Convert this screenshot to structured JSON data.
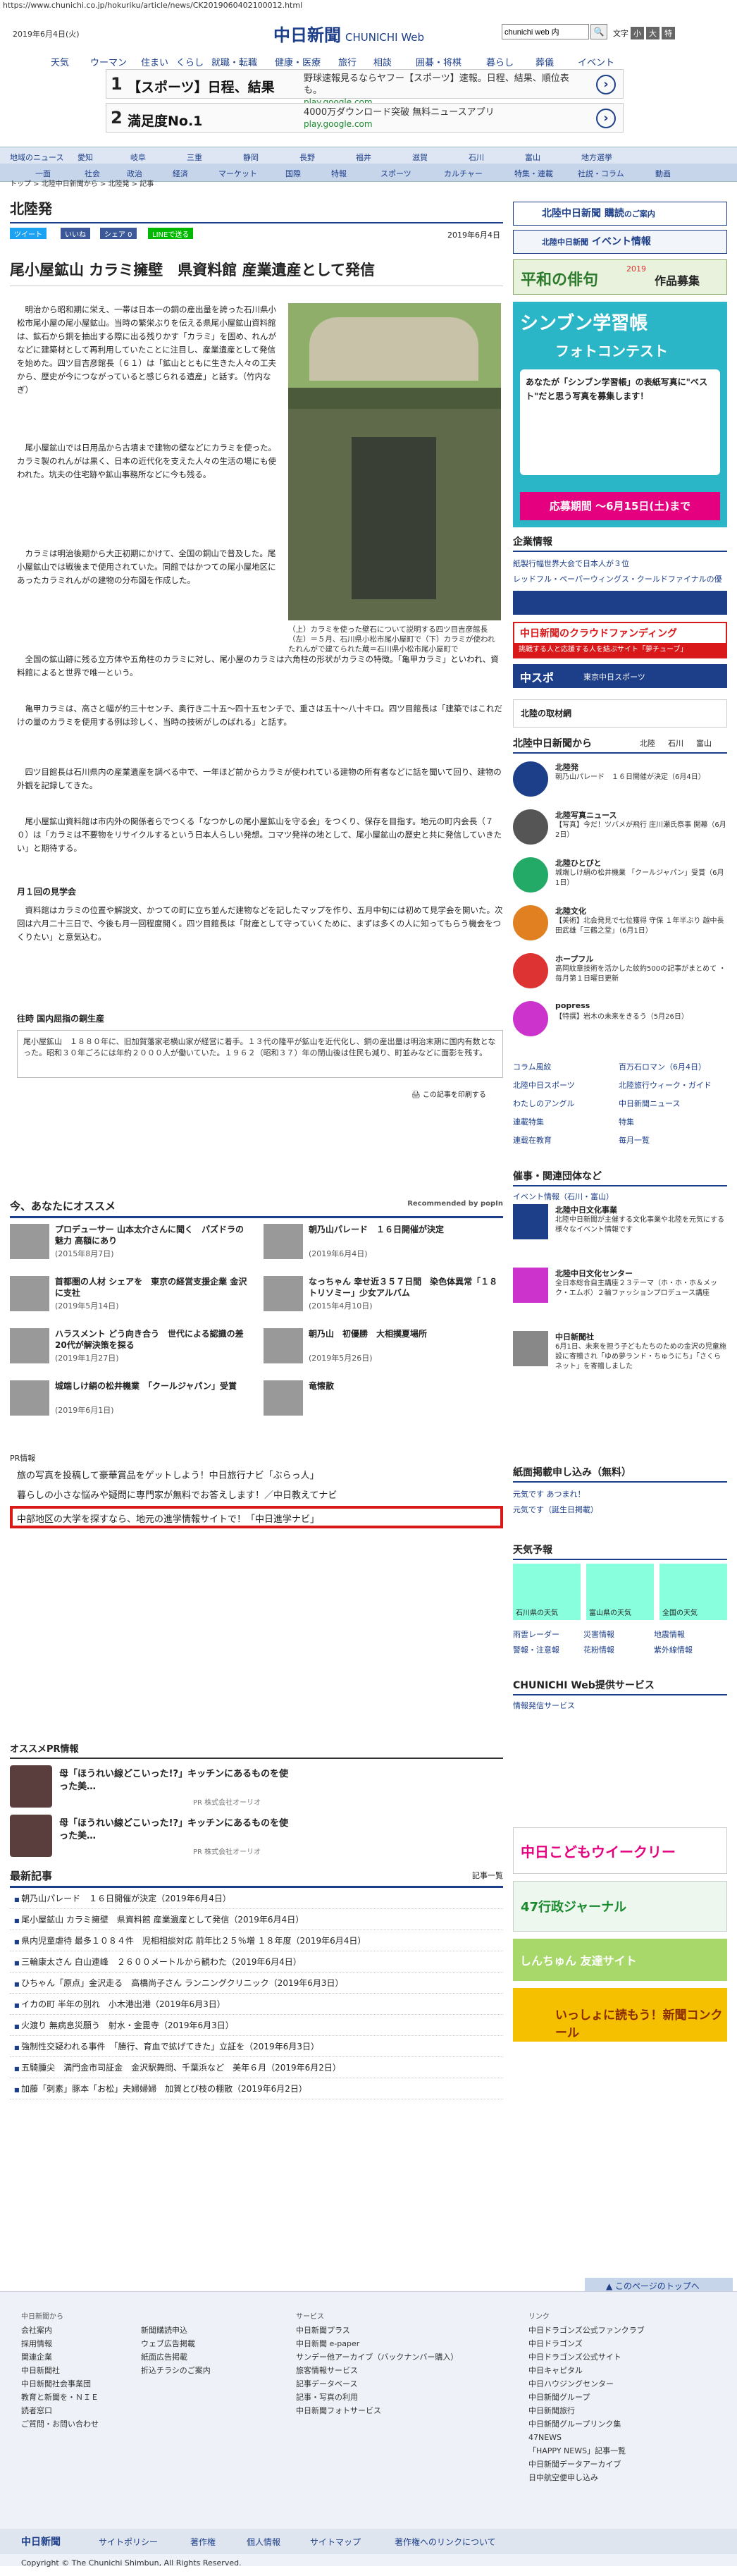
{
  "url": "https://www.chunichi.co.jp/hokuriku/article/news/CK2019060402100012.html",
  "header": {
    "date": "2019年6月4日(火)",
    "logo": "中日新聞",
    "logo_sub": "CHUNICHI Web",
    "search_value": "chunichi web 内",
    "search_btn": "🔍",
    "font_label": "文字",
    "font_s": "小",
    "font_m": "大",
    "font_l": "特"
  },
  "gnav": [
    "天気",
    "ウーマン",
    "住まい",
    "くらし",
    "就職・転職",
    "健康・医療",
    "旅行",
    "相談",
    "囲碁・将棋",
    "暮らし",
    "葬儀",
    "イベント"
  ],
  "ads": [
    {
      "n": "1",
      "t": "【スポーツ】日程、結果",
      "d": "野球速報見るならヤフー【スポーツ】速報。日程、結果、順位表も。",
      "u": "play.google.com"
    },
    {
      "n": "2",
      "t": "満足度No.1",
      "d": "4000万ダウンロード突破 無料ニュースアプリ",
      "u": "play.google.com"
    }
  ],
  "rnav1": [
    "地域のニュース",
    "愛知",
    "岐阜",
    "三重",
    "静岡",
    "長野",
    "福井",
    "滋賀",
    "石川",
    "富山",
    "地方選挙"
  ],
  "rnav2": [
    "一面",
    "社会",
    "政治",
    "経済",
    "マーケット",
    "国際",
    "特報",
    "スポーツ",
    "カルチャー",
    "特集・連載",
    "社説・コラム",
    "動画"
  ],
  "breadcrumb": "トップ > 北陸中日新聞から > 北陸発 > 記事",
  "page_title": "北陸発",
  "share": {
    "tweet": "ツイート",
    "fb_like": "いいね",
    "fb_share": "シェア 0",
    "line": "LINEで送る"
  },
  "pub_date": "2019年6月4日",
  "article": {
    "title": "尾小屋鉱山 カラミ擁壁　県資料館 産業遺産として発信",
    "p1": "明治から昭和期に栄え、一帯は日本一の銅の産出量を誇った石川県小松市尾小屋の尾小屋鉱山。当時の繁栄ぶりを伝える県尾小屋鉱山資料館は、鉱石から銅を抽出する際に出る残りかす「カラミ」を固め、れんがなどに建築材として再利用していたことに注目し、産業遺産として発信を始めた。四ツ目吉彦館長（６１）は「鉱山とともに生きた人々の工夫から、歴史が今につながっていると感じられる遺産」と話す。（竹内なぎ）",
    "p2": "尾小屋鉱山では日用品から古墳まで建物の壁などにカラミを使った。カラミ製のれんがは黒く、日本の近代化を支えた人々の生活の場にも使われた。坑夫の住宅跡や鉱山事務所などに今も残る。",
    "p3": "カラミは明治後期から大正初期にかけて、全国の銅山で普及した。尾小屋鉱山では戦後まで使用されていた。同館ではかつての尾小屋地区にあったカラミれんがの建物の分布図を作成した。",
    "p4": "全国の鉱山跡に残る立方体や五角柱のカラミに対し、尾小屋のカラミは六角柱の形状がカラミの特徴。「亀甲カラミ」といわれ、資料館によると世界で唯一という。",
    "p5": "亀甲カラミは、高さと幅が約三十センチ、奥行き二十五〜四十五センチで、重さは五十〜八十キロ。四ツ目館長は「建築ではこれだけの量のカラミを使用する例は珍しく、当時の技術がしのばれる」と話す。",
    "p6": "四ツ目館長は石川県内の産業遺産を調べる中で、一年ほど前からカラミが使われている建物の所有者などに話を聞いて回り、建物の外観を記録してきた。",
    "p7": "尾小屋鉱山資料館は市内外の関係者らでつくる「なつかしの尾小屋鉱山を守る会」をつくり、保存を目指す。地元の町内会長（７０）は「カラミは不要物をリサイクルするという日本人らしい発想。コマツ発祥の地として、尾小屋鉱山の歴史と共に発信していきたい」と期待する。",
    "sub": "月１回の見学会",
    "p8": "資料館はカラミの位置や解説文、かつての町に立ち並んだ建物などを記したマップを作り、五月中旬には初めて見学会を開いた。次回は六月二十三日で、今後も月一回程度開く。四ツ目館長は「財産として守っていくために、まずは多くの人に知ってもらう機会をつくりたい」と意気込む。",
    "sub2": "往時 国内屈指の銅生産",
    "info": "尾小屋鉱山　１８８０年に、旧加賀藩家老横山家が経営に着手。１３代の隆平が鉱山を近代化し、銅の産出量は明治末期に国内有数となった。昭和３０年ごろには年約２０００人が働いていた。１９６２（昭和３７）年の閉山後は住民も減り、町並みなどに面影を残す。",
    "caption": "（上）カラミを使った壁石について説明する四ツ目吉彦館長（左）＝５月、石川県小松市尾小屋町で（下）カラミが使われたれんがで建てられた蔵＝石川県小松市尾小屋町で",
    "print": "この記事を印刷する"
  },
  "recommend": {
    "title": "今、あなたにオススメ",
    "by": "Recommended by",
    "brand": "popIn",
    "items": [
      {
        "t": "プロデューサー 山本太介さんに聞く　パズドラの魅力 高額にあり",
        "d": "(2015年8月7日)"
      },
      {
        "t": "朝乃山パレード　１６日開催が決定",
        "d": "(2019年6月4日)"
      },
      {
        "t": "首都圏の人材 シェアを　東京の経営支援企業 金沢に支社",
        "d": "(2019年5月14日)"
      },
      {
        "t": "なっちゃん 幸せ近３５７日間　染色体異常「１８トリソミー」少女アルバム",
        "d": "(2015年4月10日)"
      },
      {
        "t": "ハラスメント どう向き合う　世代による認識の差 20代が解決策を探る",
        "d": "(2019年1月27日)"
      },
      {
        "t": "朝乃山　初優勝　大相撲夏場所",
        "d": "(2019年5月26日)"
      },
      {
        "t": "城端しけ絹の松井機業　「クールジャパン」受賞",
        "d": "(2019年6月1日)"
      },
      {
        "t": "竜懐散",
        "d": ""
      }
    ]
  },
  "pr": {
    "label": "PR情報",
    "items": [
      "旅の写真を投稿して豪華賞品をゲットしよう！中日旅行ナビ「ぶらっ人」",
      "暮らしの小さな悩みや疑問に専門家が無料でお答えします！／中日教えてナビ",
      "中部地区の大学を探すなら、地元の進学情報サイトで！「中日進学ナビ」"
    ]
  },
  "oss_pr": {
    "title": "オススメPR情報",
    "items": [
      {
        "t": "母「ほうれい線どこいった!?」キッチンにあるものを使った美…",
        "by": "PR 株式会社オーリオ"
      },
      {
        "t": "母「ほうれい線どこいった!?」キッチンにあるものを使った美…",
        "by": "PR 株式会社オーリオ"
      }
    ]
  },
  "latest": {
    "title": "最新記事",
    "more": "記事一覧",
    "items": [
      "朝乃山パレード　１６日開催が決定（2019年6月4日）",
      "尾小屋鉱山 カラミ擁壁　県資料館 産業遺産として発信（2019年6月4日）",
      "県内児童虐待 最多１０８４件　児相相談対応 前年比２５％増 １８年度（2019年6月4日）",
      "三輪康太さん 白山連峰　２６００メートルから観わた（2019年6月4日）",
      "ひちゃん「原点」金沢走る　高橋尚子さん ランニングクリニック（2019年6月3日）",
      "イカの町 半年の別れ　小木港出港（2019年6月3日）",
      "火渡り 無病息災願う　射水・金毘寺（2019年6月3日）",
      "強制性交疑われる事件　「勝行、育血で拡げてきた」立証を（2019年6月3日）",
      "五騎腫尖　満門金市司証金　金沢駅舞問、千葉浜など　美年６月（2019年6月2日）",
      "加藤「刺素」豚本「お松」夫婦婦婦　加賀とび枝の棚散（2019年6月2日）"
    ]
  },
  "side": {
    "kodoku": "北陸中日新聞 購読",
    "kodoku_sub": "のご案内",
    "event": "イベント情報",
    "event_pre": "北陸中日新聞",
    "haiku": "平和の俳句",
    "haiku_sub": "作品募集",
    "haiku_year": "2019",
    "photo_title": "シンブン学習帳",
    "photo_sub": "フォトコンテスト",
    "photo_desc": "あなたが「シンブン学習帳」の表紙写真に\"ベスト\"だと思う写真を募集します！",
    "photo_deadline": "応募期間 〜6月15日(土)まで",
    "kigyou": "企業情報",
    "kigyou_items": [
      "紙製行幅世界大会で日本人が３位",
      "レッドフル・ペーパーウィングス・クールドファイナルの優勝を狙う"
    ],
    "fund": "中日新聞のクラウドファンディング",
    "fund_sub": "挑戦する人と応援する人を結ぶサイト「夢チューブ」",
    "chunichi_sports": "中スポ",
    "chunichi_sports_sub": "東京中日スポーツ",
    "shuzai": "北陸の取材網",
    "bureau": "北陸中日新聞から",
    "tabs": [
      "北陸",
      "石川",
      "富山"
    ],
    "entries": [
      {
        "nm": "北陸発",
        "tx": "朝乃山パレード　１６日開催が決定（6月4日）"
      },
      {
        "nm": "北陸写真ニュース",
        "tx": "【写真】今だ！ツバメが飛行 庄川瀬氏祭事 開幕（6月2日）"
      },
      {
        "nm": "北陸ひとびと",
        "tx": "城端しけ絹の松井機業 「クールジャパン」受賞（6月1日）"
      },
      {
        "nm": "北陸文化",
        "tx": "【美術】北会発見で七位獲得 守保 １年半ぶり 越中長田武雄「三鶴之堂」（6月1日）"
      },
      {
        "nm": "ホープフル",
        "tx": "高岡紋章技術を活かした紋約500の記事がまとめて ・ 毎月第１日曜日更新"
      },
      {
        "nm": "popress",
        "tx": "【特撰】岩木の未来をきるう（5月26日）"
      }
    ],
    "links": [
      "コラム風紋",
      "百万石ロマン（6月4日）",
      "北陸中日スポーツ",
      "北陸旅行ウィーク・ガイド",
      "わたしのアングル",
      "中日新聞ニュース",
      "連載特集",
      "特集",
      "連载在教育",
      "毎月一覧"
    ],
    "saiji": "催事・関連団体など",
    "ev": "イベント情報（石川・富山）",
    "orgs": [
      {
        "nm": "北陸中日文化事業",
        "tx": "北陸中日新聞が主催する文化事業や北陸を元気にする様々なイベント情報です"
      },
      {
        "nm": "北陸中日文化センター",
        "tx": "全日本総合自主講座２３テーマ（ホ・ホ・ホ＆メック・エムボ）２輪ファッションプロデュース講座"
      },
      {
        "nm": "中日新聞社",
        "tx": "6月1日、未来を担う子どもたちのための金沢の児童施設に寄贈され「ゆめ夢ランド・ちゅうにち」「さくらネット」を寄贈しました"
      }
    ],
    "sub_form": "紙面掲載申し込み（無料）",
    "sub_items": [
      "元気です あつまれ！",
      "元気です（誕生日掲載）"
    ],
    "weather": "天気予報",
    "wx": [
      "石川県の天気",
      "富山県の天気",
      "全国の天気"
    ],
    "wx_links": [
      "雨雲レーダー",
      "災害情報",
      "地震情報",
      "警報・注意報",
      "花粉情報",
      "紫外線情報"
    ],
    "web": "CHUNICHI Web提供サービス",
    "web_link": "情報発信サービス",
    "b1": "中日こどもウイークリー",
    "b2": "47行政ジャーナル",
    "b3": "しんちゅん 友達サイト",
    "b4": "いっしょに読もう！新聞コンクール"
  },
  "totop": "このページのトップへ",
  "footer": {
    "c1_head": "中日新聞から",
    "c1": [
      "会社案内",
      "採用情報",
      "関連企業",
      "中日新聞社",
      "中日新聞社会事業団",
      "教育と新聞を・ＮＩＥ",
      "読者窓口",
      "ご質問・お問い合わせ"
    ],
    "c2": [
      "新聞購読申込",
      "ウェブ広告掲載",
      "紙面広告掲載",
      "折込チラシのご案内"
    ],
    "c3_head": "サービス",
    "c3": [
      "中日新聞プラス",
      "中日新聞 e-paper",
      "サンデー他アーカイブ（バックナンバー購入）",
      "旅客情報サービス",
      "記事データベース",
      "記事・写真の利用",
      "中日新聞フォトサービス"
    ],
    "c4_head": "リンク",
    "c4": [
      "中日ドラゴンズ公式ファンクラブ",
      "中日ドラゴンズ",
      "中日ドラゴンズ公式サイト",
      "中日キャピタル",
      "中日ハウジングセンター",
      "中日新聞グループ",
      "中日新聞旅行",
      "中日新聞グループリンク集",
      "47NEWS",
      "「HAPPY NEWS」記事一覧",
      "中日新聞データアーカイブ",
      "日中航空便申し込み"
    ],
    "nav": [
      "中日新聞",
      "サイトポリシー",
      "著作権",
      "個人情報",
      "サイトマップ",
      "著作権へのリンクについて"
    ],
    "copy": "Copyright © The Chunichi Shimbun, All Rights Reserved."
  }
}
